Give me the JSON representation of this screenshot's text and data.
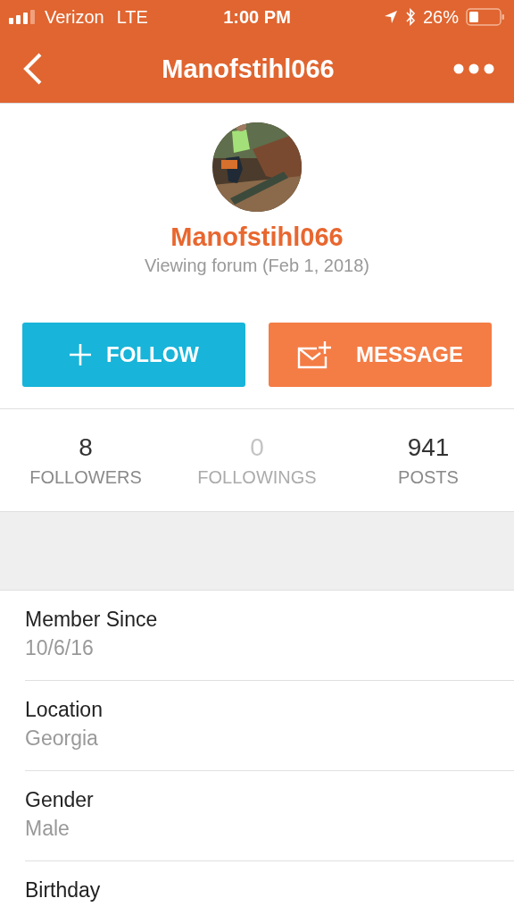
{
  "status_bar": {
    "carrier": "Verizon",
    "network": "LTE",
    "time": "1:00 PM",
    "battery": "26%"
  },
  "nav": {
    "title": "Manofstihl066"
  },
  "profile": {
    "name": "Manofstihl066",
    "activity": "Viewing forum (Feb 1, 2018)"
  },
  "buttons": [
    {
      "kind": "follow",
      "label": "FOLLOW"
    },
    {
      "kind": "message",
      "label": "MESSAGE"
    }
  ],
  "stats": [
    {
      "value": "8",
      "label": "FOLLOWERS",
      "disabled": false
    },
    {
      "value": "0",
      "label": "FOLLOWINGS",
      "disabled": true
    },
    {
      "value": "941",
      "label": "POSTS",
      "disabled": false
    }
  ],
  "details": [
    {
      "label": "Member Since",
      "value": "10/6/16"
    },
    {
      "label": "Location",
      "value": "Georgia"
    },
    {
      "label": "Gender",
      "value": "Male"
    },
    {
      "label": "Birthday"
    }
  ]
}
